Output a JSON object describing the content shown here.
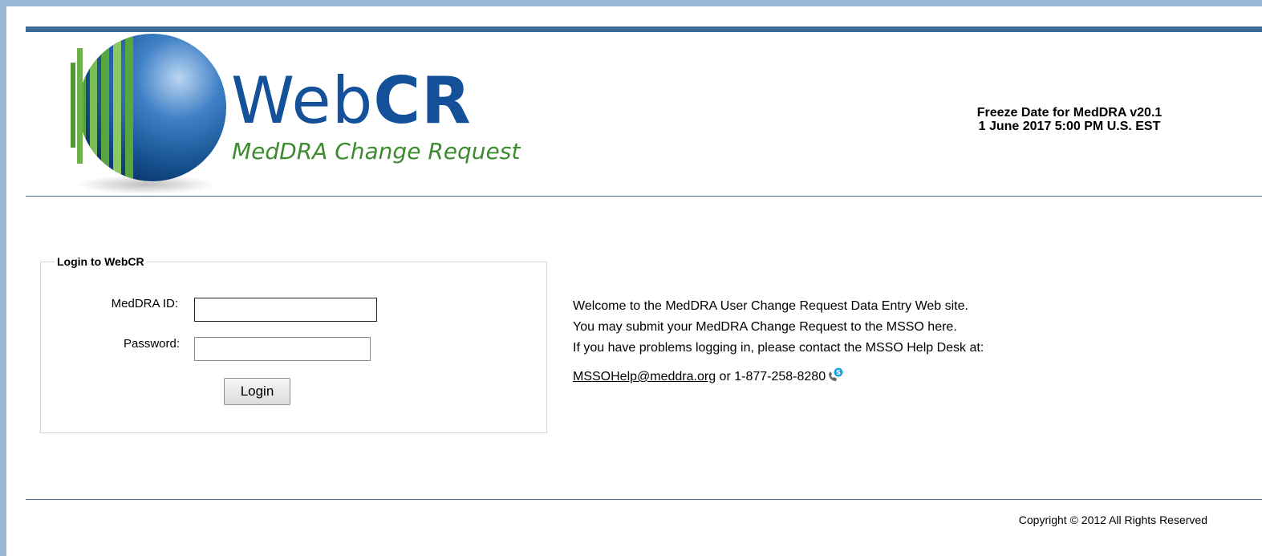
{
  "header": {
    "logo_word_regular": "Web",
    "logo_word_bold": "CR",
    "logo_subtitle": "MedDRA Change Request",
    "freeze_line1": "Freeze Date for MedDRA v20.1",
    "freeze_line2": "1 June 2017 5:00 PM U.S. EST"
  },
  "login": {
    "legend": "Login to WebCR",
    "id_label": "MedDRA ID:",
    "id_value": "",
    "password_label": "Password:",
    "password_value": "",
    "button_label": "Login"
  },
  "welcome": {
    "line1": "Welcome to the MedDRA User Change Request Data Entry Web site.",
    "line2": "You may submit your MedDRA Change Request to the MSSO here.",
    "line3": "If you have problems logging in, please contact the MSSO Help Desk at:",
    "email": "MSSOHelp@meddra.org",
    "or_text": " or ",
    "phone": "1-877-258-8280"
  },
  "footer": {
    "copyright": "Copyright © 2012 All Rights Reserved"
  },
  "colors": {
    "accent_blue": "#3b6c99",
    "logo_blue": "#14519a",
    "logo_green": "#3d8b2f",
    "outer_background": "#9ab8d8"
  }
}
